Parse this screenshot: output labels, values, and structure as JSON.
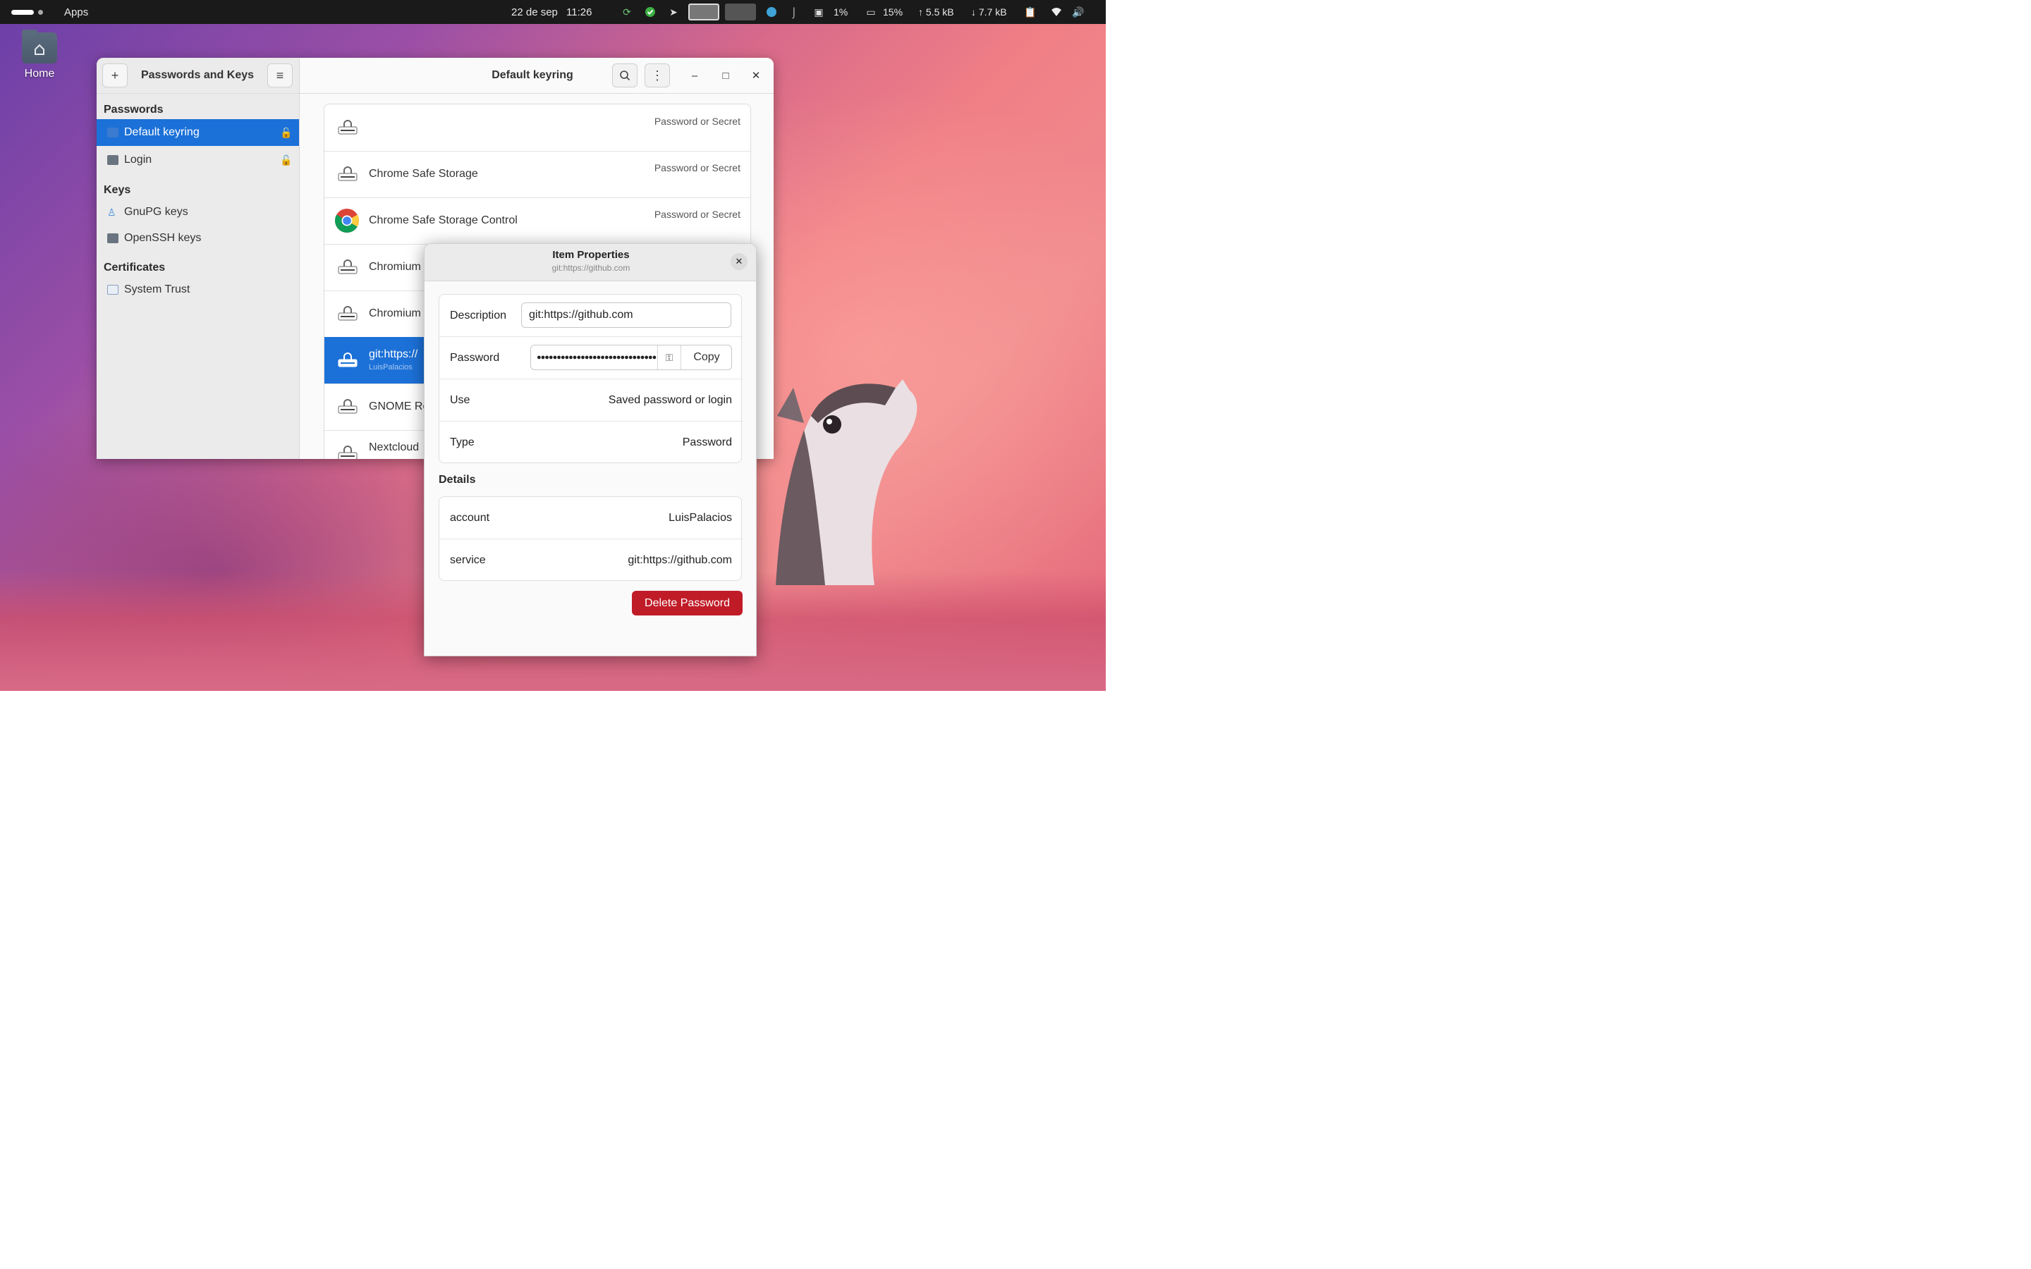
{
  "topbar": {
    "apps_label": "Apps",
    "date": "22 de sep",
    "time": "11:26",
    "cpu": "1%",
    "mem": "15%",
    "upload": "5.5 kB",
    "download": "7.7 kB"
  },
  "desktop": {
    "home_label": "Home"
  },
  "window": {
    "sidebar_title": "Passwords and Keys",
    "content_title": "Default keyring",
    "sections": {
      "passwords": "Passwords",
      "keys": "Keys",
      "certificates": "Certificates"
    },
    "sidebar_items": [
      {
        "label": "Default keyring"
      },
      {
        "label": "Login"
      },
      {
        "label": "GnuPG keys"
      },
      {
        "label": "OpenSSH keys"
      },
      {
        "label": "System Trust"
      }
    ],
    "items": [
      {
        "name": "",
        "kind": "Password or Secret"
      },
      {
        "name": "Chrome Safe Storage",
        "kind": "Password or Secret"
      },
      {
        "name": "Chrome Safe Storage Control",
        "kind": "Password or Secret"
      },
      {
        "name": "Chromium",
        "kind": ""
      },
      {
        "name": "Chromium",
        "kind": ""
      },
      {
        "name": "git:https://",
        "sub": "LuisPalacios",
        "kind": ""
      },
      {
        "name": "GNOME Re",
        "kind": ""
      },
      {
        "name": "Nextcloud",
        "kind": ""
      }
    ]
  },
  "dialog": {
    "title": "Item Properties",
    "subtitle": "git:https://github.com",
    "description_label": "Description",
    "description_value": "git:https://github.com",
    "password_label": "Password",
    "password_masked": "●●●●●●●●●●●●●●●●●●●●●●●●●●●●●●●●●●●●●●●●",
    "copy_label": "Copy",
    "use_label": "Use",
    "use_value": "Saved password or login",
    "type_label": "Type",
    "type_value": "Password",
    "details_title": "Details",
    "account_label": "account",
    "account_value": "LuisPalacios",
    "service_label": "service",
    "service_value": "git:https://github.com",
    "delete_label": "Delete Password"
  },
  "colors": {
    "accent": "#1c71d8",
    "destructive": "#c01c28",
    "topbar": "#1a1a1a"
  },
  "icons": [
    "home-folder-icon",
    "add-icon",
    "menu-icon",
    "search-icon",
    "kebab-icon",
    "minimize-icon",
    "maximize-icon",
    "close-icon",
    "folder-icon",
    "lock-icon",
    "gnupg-icon",
    "openssh-icon",
    "system-trust-icon",
    "keyring-item-icon",
    "chrome-icon",
    "key-icon",
    "wifi-icon",
    "volume-icon",
    "clipboard-icon"
  ]
}
